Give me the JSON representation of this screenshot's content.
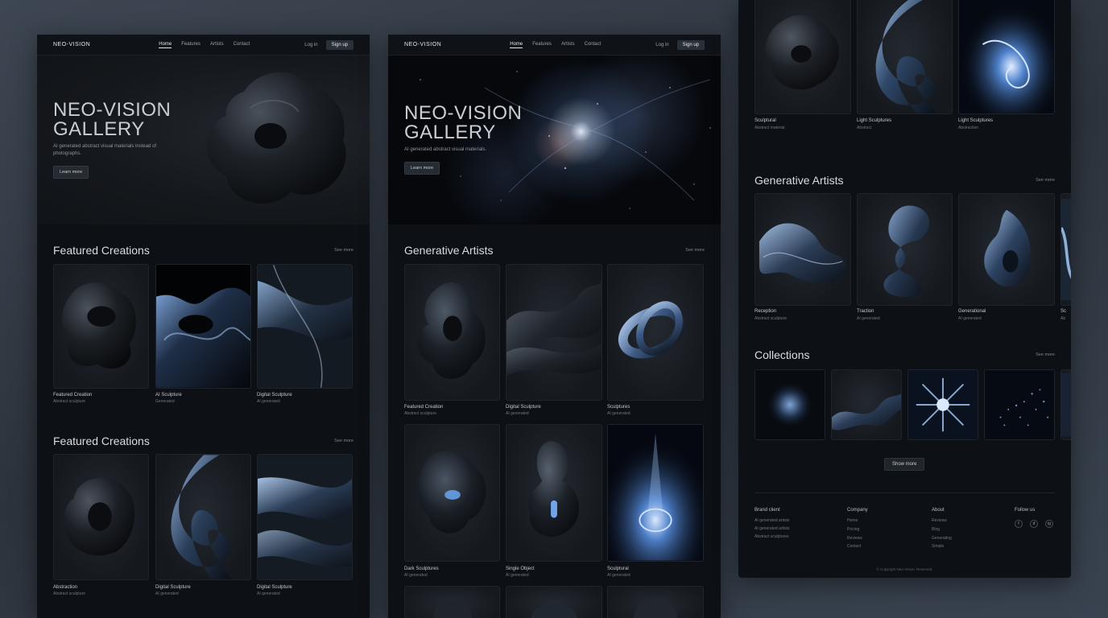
{
  "nav": {
    "logo": "NEO-VISION",
    "links": [
      "Home",
      "Features",
      "Artists",
      "Contact"
    ],
    "links_a": [
      "Home",
      "Features",
      "Artists",
      "Contact"
    ],
    "login": "Log in",
    "signup": "Sign up"
  },
  "panel_a": {
    "hero": {
      "title_line1": "NEO-VISION",
      "title_line2": "GALLERY",
      "subtitle": "AI generated abstract visual materials instead of photographs.",
      "button": "Learn more"
    },
    "section1": {
      "title": "Featured Creations",
      "see_more": "See more",
      "cards": [
        {
          "title": "Featured Creation",
          "sub": "Abstract sculpture"
        },
        {
          "title": "AI Sculpture",
          "sub": "Generated"
        },
        {
          "title": "Digital Sculpture",
          "sub": "AI generated"
        }
      ]
    },
    "section2": {
      "title": "Featured Creations",
      "see_more": "See more",
      "cards": [
        {
          "title": "Abstraction",
          "sub": "Abstract sculpture"
        },
        {
          "title": "Digital Sculpture",
          "sub": "AI generated"
        },
        {
          "title": "Digital Sculpture",
          "sub": "AI generated"
        }
      ]
    }
  },
  "panel_b": {
    "hero": {
      "title_line1": "NEO-VISION",
      "title_line2": "GALLERY",
      "subtitle": "AI generated abstract visual materials.",
      "button": "Learn more"
    },
    "section1": {
      "title": "Generative Artists",
      "see_more": "See more",
      "cards": [
        {
          "title": "Featured Creation",
          "sub": "Abstract sculpture"
        },
        {
          "title": "Digital Sculpture",
          "sub": "AI generated"
        },
        {
          "title": "Sculptures",
          "sub": "AI generated"
        },
        {
          "title": "Dark Sculptures",
          "sub": "AI generated"
        },
        {
          "title": "Single Object",
          "sub": "AI generated"
        },
        {
          "title": "Sculptural",
          "sub": "AI generated"
        }
      ]
    }
  },
  "panel_c": {
    "top_cards": [
      {
        "title": "Sculptural",
        "sub": "Abstract material"
      },
      {
        "title": "Light Sculptures",
        "sub": "Abstract"
      },
      {
        "title": "Light Sculptures",
        "sub": "Abstraction"
      }
    ],
    "section1": {
      "title": "Generative Artists",
      "see_more": "See more",
      "cards": [
        {
          "title": "Reception",
          "sub": "Abstract sculpture"
        },
        {
          "title": "Traction",
          "sub": "AI generated"
        },
        {
          "title": "Generational",
          "sub": "AI generated"
        },
        {
          "title": "Sc",
          "sub": "Ab"
        }
      ]
    },
    "section2": {
      "title": "Collections",
      "see_more": "See more"
    },
    "show_more": "Show more",
    "footer": {
      "col1_head": "Brand client",
      "col1_items": [
        "AI generated artists",
        "AI generated artists",
        "Abstract sculptures"
      ],
      "col2_head": "Company",
      "col2_items": [
        "Home",
        "Pricing",
        "Reviews",
        "Contact"
      ],
      "col3_head": "About",
      "col3_items": [
        "Reviews",
        "Blog",
        "Generating",
        "Simple"
      ],
      "col4_head": "Follow us",
      "social": [
        "f",
        "d",
        "ig"
      ],
      "copyright": "© Copyright Neo-Vision. Reserved."
    }
  },
  "colors": {
    "background": "#333b45",
    "panel": "#0d1014",
    "accent_blue": "#5b8fd6"
  }
}
